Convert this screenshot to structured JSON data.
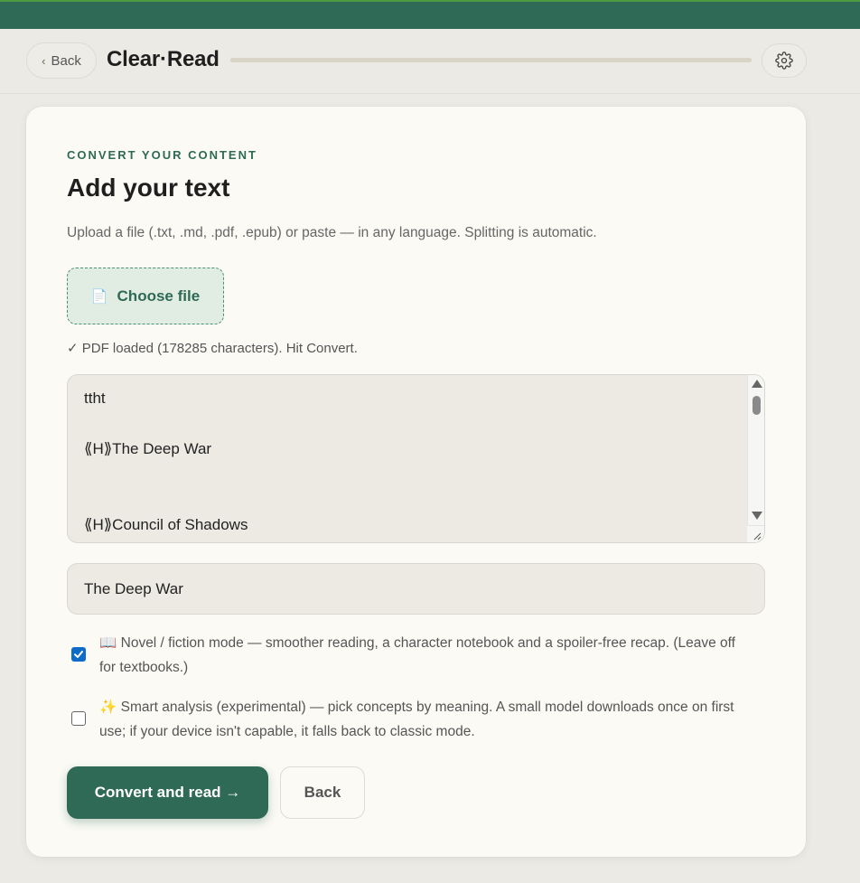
{
  "header": {
    "back_label": "Back",
    "brand": "Clear·Read",
    "progress_fraction": 1.0
  },
  "card": {
    "eyebrow": "CONVERT YOUR CONTENT",
    "heading": "Add your text",
    "subtitle": "Upload a file (.txt, .md, .pdf, .epub) or paste — in any language. Splitting is automatic.",
    "choose_file_label": "Choose file",
    "file_icon": "📄",
    "status": "✓ PDF loaded (178285 characters). Hit Convert.",
    "textarea_lines": [
      "ttht",
      "⟪H⟫The Deep War",
      "⟪H⟫Council of Shadows"
    ],
    "title_value": "The Deep War",
    "novel_mode": {
      "checked": true,
      "icon": "📖",
      "text": "Novel / fiction mode — smoother reading, a character notebook and a spoiler-free recap. (Leave off for textbooks.)"
    },
    "smart_analysis": {
      "checked": false,
      "icon": "✨",
      "text": "Smart analysis (experimental) — pick concepts by meaning. A small model downloads once on first use; if your device isn't capable, it falls back to classic mode."
    },
    "convert_label": "Convert and read →",
    "back_label": "Back"
  },
  "colors": {
    "accent": "#2E6A55",
    "checkbox": "#0E6CC8",
    "background": "#ECEAE4",
    "card": "#FBFAF5"
  }
}
